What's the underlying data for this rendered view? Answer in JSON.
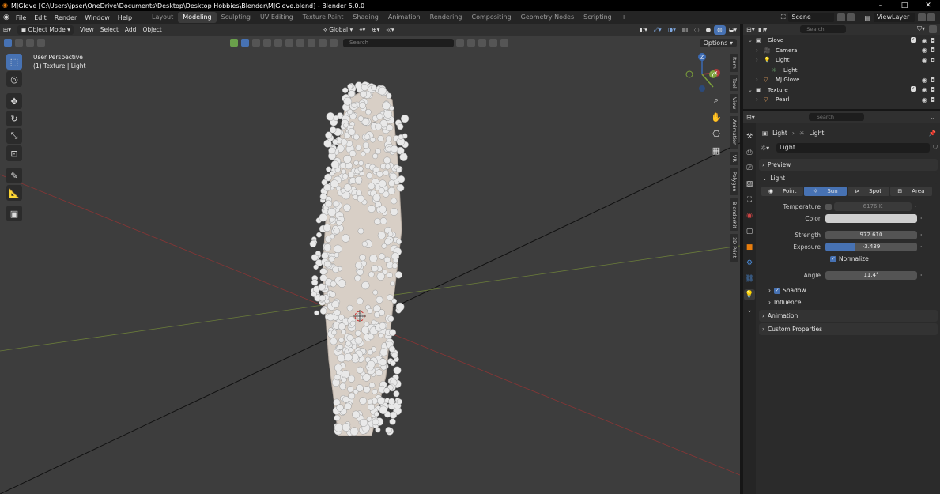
{
  "titlebar": {
    "title": "MJGlove [C:\\Users\\jpser\\OneDrive\\Documents\\Desktop\\Desktop Hobbies\\Blender\\MJGlove.blend] - Blender 5.0.0",
    "minimize": "–",
    "maximize": "□",
    "close": "✕"
  },
  "menu": [
    "File",
    "Edit",
    "Render",
    "Window",
    "Help"
  ],
  "workspaces": [
    "Layout",
    "Modeling",
    "Sculpting",
    "UV Editing",
    "Texture Paint",
    "Shading",
    "Animation",
    "Rendering",
    "Compositing",
    "Geometry Nodes",
    "Scripting"
  ],
  "active_workspace": "Modeling",
  "add_tab": "+",
  "scene": {
    "label": "Scene",
    "viewlayer": "ViewLayer"
  },
  "viewport_header": {
    "mode": "Object Mode",
    "view": "View",
    "select": "Select",
    "add": "Add",
    "object": "Object",
    "orientation": "Global",
    "search_placeholder": "Search",
    "options": "Options"
  },
  "viewport": {
    "perspective": "User Perspective",
    "context": "(1) Texture | Light"
  },
  "gizmo": {
    "z": "Z",
    "y": "Y",
    "x": "X"
  },
  "side_tabs": [
    "Item",
    "Tool",
    "View",
    "Animation",
    "VR",
    "Polygon",
    "BlenderKit",
    "3D Print"
  ],
  "outliner": {
    "search_placeholder": "Search",
    "rows": [
      {
        "label": "Glove",
        "indent": 0,
        "type": "collection"
      },
      {
        "label": "Camera",
        "indent": 1,
        "type": "camera"
      },
      {
        "label": "Light",
        "indent": 1,
        "type": "light"
      },
      {
        "label": "Light",
        "indent": 2,
        "type": "lightdata"
      },
      {
        "label": "MJ Glove",
        "indent": 1,
        "type": "mesh"
      },
      {
        "label": "Texture",
        "indent": 0,
        "type": "collection"
      },
      {
        "label": "Pearl",
        "indent": 1,
        "type": "mesh"
      }
    ]
  },
  "properties": {
    "search_placeholder": "Search",
    "breadcrumb": [
      "Light",
      "Light"
    ],
    "datablock": "Light",
    "sections": {
      "preview": "Preview",
      "light": "Light",
      "animation": "Animation",
      "custom": "Custom Properties"
    },
    "light_types": [
      "Point",
      "Sun",
      "Spot",
      "Area"
    ],
    "active_light_type": "Sun",
    "temperature_label": "Temperature",
    "temperature_value": "6176 K",
    "color_label": "Color",
    "strength_label": "Strength",
    "strength_value": "972.610",
    "exposure_label": "Exposure",
    "exposure_value": "-3.439",
    "normalize_label": "Normalize",
    "angle_label": "Angle",
    "angle_value": "11.4°",
    "shadow_label": "Shadow",
    "influence_label": "Influence"
  },
  "colors": {
    "accent": "#4772b3",
    "axis_x": "#b33b3b",
    "axis_y": "#7ca13b",
    "axis_z": "#3b6ab3"
  }
}
